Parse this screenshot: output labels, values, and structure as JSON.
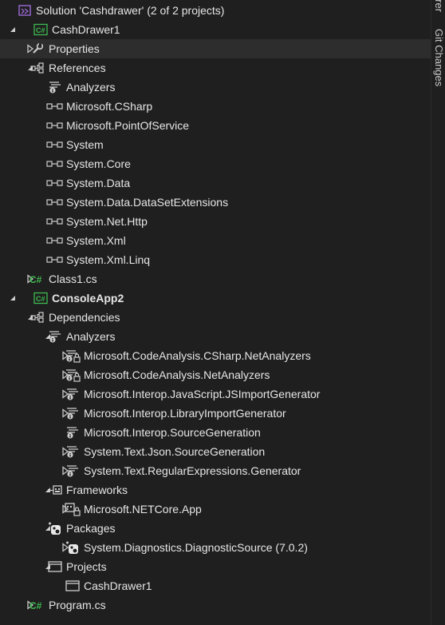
{
  "side_panel": {
    "top_text": "orer",
    "git_changes": "Git Changes"
  },
  "tree": [
    {
      "label": "Solution 'Cashdrawer' (2 of 2 projects)",
      "level": 0,
      "expander": "none",
      "icon": "solution-icon"
    },
    {
      "label": "CashDrawer1",
      "level": 0,
      "expander": "open",
      "icon": "csharp-project-icon"
    },
    {
      "label": "Properties",
      "level": 1,
      "expander": "closed",
      "icon": "wrench-icon",
      "selected": true
    },
    {
      "label": "References",
      "level": 1,
      "expander": "open",
      "icon": "references-icon"
    },
    {
      "label": "Analyzers",
      "level": 2,
      "expander": "none",
      "icon": "analyzer-icon"
    },
    {
      "label": "Microsoft.CSharp",
      "level": 2,
      "expander": "none",
      "icon": "reference-icon"
    },
    {
      "label": "Microsoft.PointOfService",
      "level": 2,
      "expander": "none",
      "icon": "reference-icon"
    },
    {
      "label": "System",
      "level": 2,
      "expander": "none",
      "icon": "reference-icon"
    },
    {
      "label": "System.Core",
      "level": 2,
      "expander": "none",
      "icon": "reference-icon"
    },
    {
      "label": "System.Data",
      "level": 2,
      "expander": "none",
      "icon": "reference-icon"
    },
    {
      "label": "System.Data.DataSetExtensions",
      "level": 2,
      "expander": "none",
      "icon": "reference-icon"
    },
    {
      "label": "System.Net.Http",
      "level": 2,
      "expander": "none",
      "icon": "reference-icon"
    },
    {
      "label": "System.Xml",
      "level": 2,
      "expander": "none",
      "icon": "reference-icon"
    },
    {
      "label": "System.Xml.Linq",
      "level": 2,
      "expander": "none",
      "icon": "reference-icon"
    },
    {
      "label": "Class1.cs",
      "level": 1,
      "expander": "closed",
      "icon": "csharp-file-icon"
    },
    {
      "label": "ConsoleApp2",
      "level": 0,
      "expander": "open",
      "icon": "csharp-project-icon",
      "bold": true
    },
    {
      "label": "Dependencies",
      "level": 1,
      "expander": "open",
      "icon": "references-icon"
    },
    {
      "label": "Analyzers",
      "level": 2,
      "expander": "open",
      "icon": "analyzer-icon"
    },
    {
      "label": "Microsoft.CodeAnalysis.CSharp.NetAnalyzers",
      "level": 3,
      "expander": "closed",
      "icon": "analyzer-lock-icon"
    },
    {
      "label": "Microsoft.CodeAnalysis.NetAnalyzers",
      "level": 3,
      "expander": "closed",
      "icon": "analyzer-lock-icon"
    },
    {
      "label": "Microsoft.Interop.JavaScript.JSImportGenerator",
      "level": 3,
      "expander": "closed",
      "icon": "analyzer-icon"
    },
    {
      "label": "Microsoft.Interop.LibraryImportGenerator",
      "level": 3,
      "expander": "closed",
      "icon": "analyzer-icon"
    },
    {
      "label": "Microsoft.Interop.SourceGeneration",
      "level": 3,
      "expander": "none",
      "icon": "analyzer-icon"
    },
    {
      "label": "System.Text.Json.SourceGeneration",
      "level": 3,
      "expander": "closed",
      "icon": "analyzer-icon"
    },
    {
      "label": "System.Text.RegularExpressions.Generator",
      "level": 3,
      "expander": "closed",
      "icon": "analyzer-icon"
    },
    {
      "label": "Frameworks",
      "level": 2,
      "expander": "open",
      "icon": "framework-icon"
    },
    {
      "label": "Microsoft.NETCore.App",
      "level": 3,
      "expander": "closed",
      "icon": "framework-lock-icon"
    },
    {
      "label": "Packages",
      "level": 2,
      "expander": "open",
      "icon": "package-icon"
    },
    {
      "label": "System.Diagnostics.DiagnosticSource (7.0.2)",
      "level": 3,
      "expander": "closed",
      "icon": "package-icon"
    },
    {
      "label": "Projects",
      "level": 2,
      "expander": "open",
      "icon": "project-ref-icon"
    },
    {
      "label": "CashDrawer1",
      "level": 3,
      "expander": "none",
      "icon": "project-ref-icon"
    },
    {
      "label": "Program.cs",
      "level": 1,
      "expander": "closed",
      "icon": "csharp-file-icon"
    }
  ],
  "colors": {
    "background": "#1f1f1f",
    "selected_row": "#2d2d2d",
    "csharp_green": "#3fb950",
    "solution_purple": "#9b6bd6"
  }
}
